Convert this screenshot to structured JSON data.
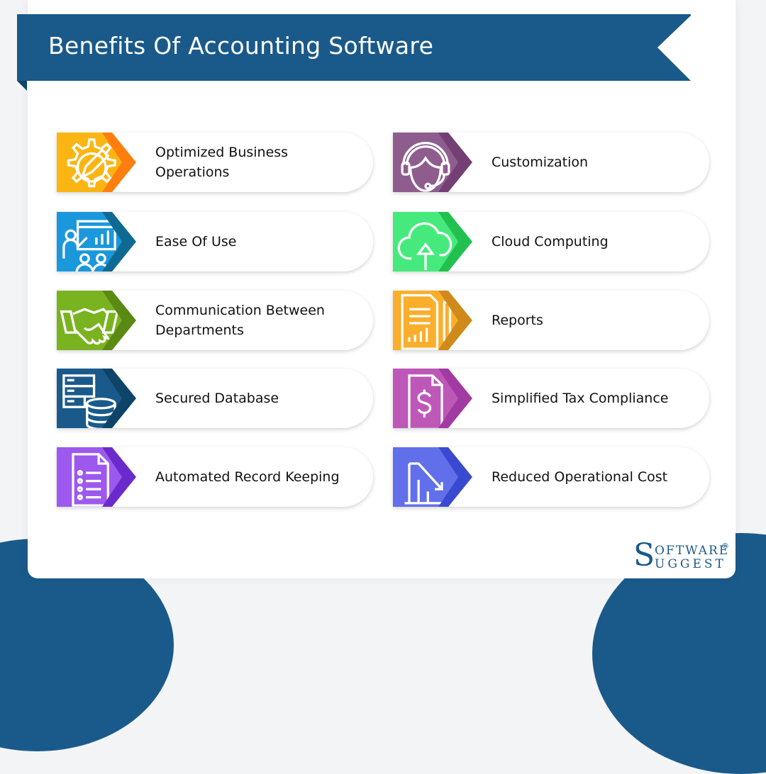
{
  "title": "Benefits Of Accounting Software",
  "brand": {
    "primary_color": "#1a5a8a",
    "logo_initial_top": "S",
    "logo_word_top": "OFTWARE",
    "logo_word_bottom": "UGGEST",
    "logo_registered": "®"
  },
  "benefits": [
    {
      "label": "Optimized Business Operations",
      "icon": "gear-pencil-icon",
      "color_main": "#fbb513",
      "color_accent": "#ff7e0e",
      "column": "left"
    },
    {
      "label": "Ease Of Use",
      "icon": "presentation-icon",
      "color_main": "#1b97db",
      "color_accent": "#0f6a93",
      "column": "left"
    },
    {
      "label": "Communication Between Departments",
      "icon": "handshake-icon",
      "color_main": "#7ab320",
      "color_accent": "#5a8a14",
      "column": "left"
    },
    {
      "label": "Secured Database",
      "icon": "database-server-icon",
      "color_main": "#1a5a8a",
      "color_accent": "#0f4469",
      "column": "left"
    },
    {
      "label": "Automated Record Keeping",
      "icon": "document-list-icon",
      "color_main": "#9d59ee",
      "color_accent": "#6b2bcc",
      "column": "left"
    },
    {
      "label": "Customization",
      "icon": "headset-support-icon",
      "color_main": "#8e5d8e",
      "color_accent": "#743f73",
      "column": "right"
    },
    {
      "label": "Cloud Computing",
      "icon": "cloud-upload-icon",
      "color_main": "#46ea7c",
      "color_accent": "#22c04f",
      "column": "right"
    },
    {
      "label": "Reports",
      "icon": "report-chart-icon",
      "color_main": "#fbae2b",
      "color_accent": "#d08a1b",
      "column": "right"
    },
    {
      "label": "Simplified Tax Compliance",
      "icon": "tax-document-icon",
      "color_main": "#bd58b8",
      "color_accent": "#a13aa3",
      "column": "right"
    },
    {
      "label": "Reduced Operational Cost",
      "icon": "cost-down-chart-icon",
      "color_main": "#6170ea",
      "color_accent": "#3a4ad0",
      "column": "right"
    }
  ]
}
